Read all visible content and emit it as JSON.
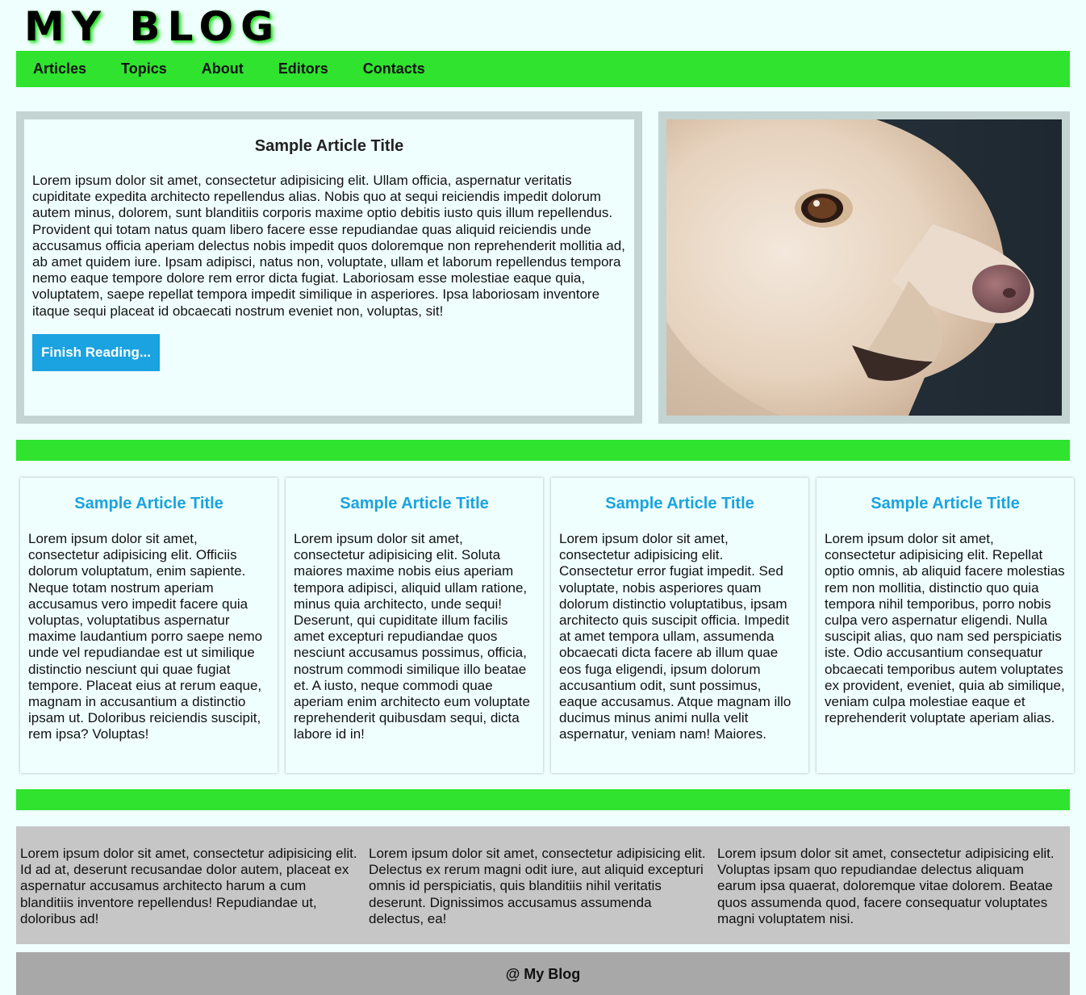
{
  "site": {
    "title": "MY BLOG"
  },
  "nav": {
    "items": [
      "Articles",
      "Topics",
      "About",
      "Editors",
      "Contacts"
    ]
  },
  "hero": {
    "title": "Sample Article Title",
    "text": "Lorem ipsum dolor sit amet, consectetur adipisicing elit. Ullam officia, aspernatur veritatis cupiditate expedita architecto repellendus alias. Nobis quo at sequi reiciendis impedit dolorum autem minus, dolorem, sunt blanditiis corporis maxime optio debitis iusto quis illum repellendus. Provident qui totam natus quam libero facere esse repudiandae quas aliquid reiciendis unde accusamus officia aperiam delectus nobis impedit quos doloremque non reprehenderit mollitia ad, ab amet quidem iure. Ipsam adipisci, natus non, voluptate, ullam et laborum repellendus tempora nemo eaque tempore dolore rem error dicta fugiat. Laboriosam esse molestiae eaque quia, voluptatem, saepe repellat tempora impedit similique in asperiores. Ipsa laboriosam inventore itaque sequi placeat id obcaecati nostrum eveniet non, voluptas, sit!",
    "button_label": "Finish Reading..."
  },
  "cards": [
    {
      "title": "Sample Article Title",
      "text": "Lorem ipsum dolor sit amet, consectetur adipisicing elit. Officiis dolorum voluptatum, enim sapiente. Neque totam nostrum aperiam accusamus vero impedit facere quia voluptas, voluptatibus aspernatur maxime laudantium porro saepe nemo unde vel repudiandae est ut similique distinctio nesciunt qui quae fugiat tempore. Placeat eius at rerum eaque, magnam in accusantium a distinctio ipsam ut. Doloribus reiciendis suscipit, rem ipsa? Voluptas!"
    },
    {
      "title": "Sample Article Title",
      "text": "Lorem ipsum dolor sit amet, consectetur adipisicing elit. Soluta maiores maxime nobis eius aperiam tempora adipisci, aliquid ullam ratione, minus quia architecto, unde sequi! Deserunt, qui cupiditate illum facilis amet excepturi repudiandae quos nesciunt accusamus possimus, officia, nostrum commodi similique illo beatae et. A iusto, neque commodi quae aperiam enim architecto eum voluptate reprehenderit quibusdam sequi, dicta labore id in!"
    },
    {
      "title": "Sample Article Title",
      "text": "Lorem ipsum dolor sit amet, consectetur adipisicing elit. Consectetur error fugiat impedit. Sed voluptate, nobis asperiores quam dolorum distinctio voluptatibus, ipsam architecto quis suscipit officia. Impedit at amet tempora ullam, assumenda obcaecati dicta facere ab illum quae eos fuga eligendi, ipsum dolorum accusantium odit, sunt possimus, eaque accusamus. Atque magnam illo ducimus minus animi nulla velit aspernatur, veniam nam! Maiores."
    },
    {
      "title": "Sample Article Title",
      "text": "Lorem ipsum dolor sit amet, consectetur adipisicing elit. Repellat optio omnis, ab aliquid facere molestias rem non mollitia, distinctio quo quia tempora nihil temporibus, porro nobis culpa vero aspernatur eligendi. Nulla suscipit alias, quo nam sed perspiciatis iste. Odio accusantium consequatur obcaecati temporibus autem voluptates ex provident, eveniet, quia ab similique, veniam culpa molestiae eaque et reprehenderit voluptate aperiam alias."
    }
  ],
  "info": [
    "Lorem ipsum dolor sit amet, consectetur adipisicing elit. Id ad at, deserunt recusandae dolor autem, placeat ex aspernatur accusamus architecto harum a cum blanditiis inventore repellendus! Repudiandae ut, doloribus ad!",
    "Lorem ipsum dolor sit amet, consectetur adipisicing elit. Delectus ex rerum magni odit iure, aut aliquid excepturi omnis id perspiciatis, quis blanditiis nihil veritatis deserunt. Dignissimos accusamus assumenda delectus, ea!",
    "Lorem ipsum dolor sit amet, consectetur adipisicing elit. Voluptas ipsam quo repudiandae delectus aliquam earum ipsa quaerat, doloremque vitae dolorem. Beatae quos assumenda quod, facere consequatur voluptates magni voluptatem nisi."
  ],
  "footer": {
    "text": "@ My Blog"
  },
  "colors": {
    "nav_green": "#2fe32f",
    "link_blue": "#1aa3e0",
    "page_bg": "#effffd"
  }
}
